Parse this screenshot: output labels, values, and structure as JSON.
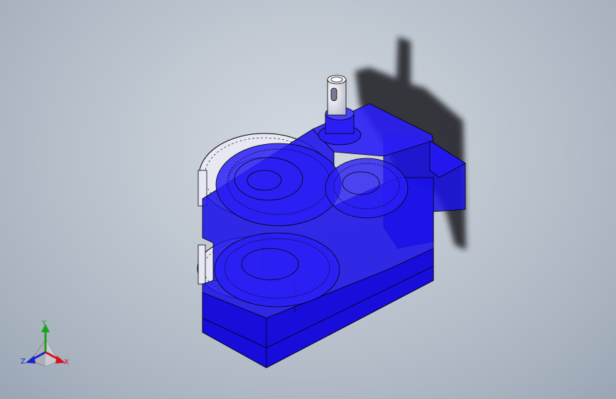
{
  "viewport": {
    "background_top": "#d3d9e1",
    "background_bottom": "#9aa5b4"
  },
  "model": {
    "body_color": "#1a12e8",
    "gear_color": "#e8e8f2",
    "shaft_color": "#dcdcea",
    "edge_color": "#000000",
    "shadow_color": "#1e1e22"
  },
  "triad": {
    "x_label": "X",
    "y_label": "Y",
    "z_label": "Z",
    "x_color": "#d8121b",
    "y_color": "#1ea21e",
    "z_color": "#1a22d0"
  }
}
